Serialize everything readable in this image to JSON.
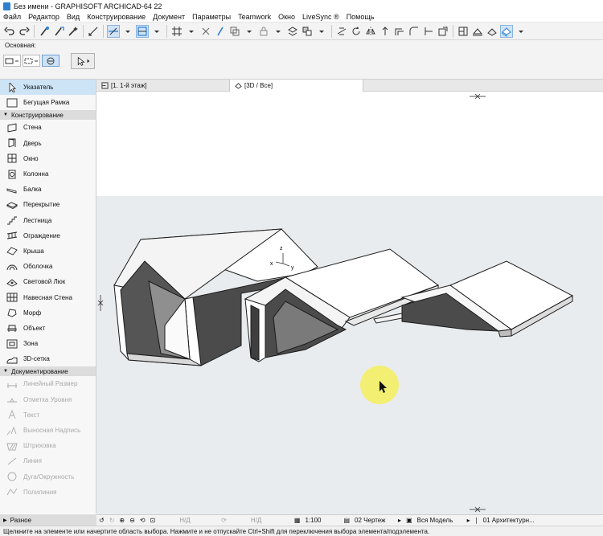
{
  "window": {
    "title": "Без имени - GRAPHISOFT ARCHICAD-64 22"
  },
  "menu": [
    "Файл",
    "Редактор",
    "Вид",
    "Конструирование",
    "Документ",
    "Параметры",
    "Teamwork",
    "Окно",
    "LiveSync ®",
    "Помощь"
  ],
  "infobox": {
    "label": "Основная:"
  },
  "tabs": [
    {
      "label": "[1. 1-й этаж]"
    },
    {
      "label": "[3D / Все]"
    }
  ],
  "toolbox": {
    "top_tools": [
      {
        "label": "Указатель",
        "icon": "pointer-icon"
      },
      {
        "label": "Бегущая Рамка",
        "icon": "marquee-icon"
      }
    ],
    "design_section": "Конструирование",
    "design_tools": [
      {
        "label": "Стена",
        "icon": "wall-icon"
      },
      {
        "label": "Дверь",
        "icon": "door-icon"
      },
      {
        "label": "Окно",
        "icon": "window-icon"
      },
      {
        "label": "Колонна",
        "icon": "column-icon"
      },
      {
        "label": "Балка",
        "icon": "beam-icon"
      },
      {
        "label": "Перекрытие",
        "icon": "slab-icon"
      },
      {
        "label": "Лестница",
        "icon": "stair-icon"
      },
      {
        "label": "Ограждение",
        "icon": "railing-icon"
      },
      {
        "label": "Крыша",
        "icon": "roof-icon"
      },
      {
        "label": "Оболочка",
        "icon": "shell-icon"
      },
      {
        "label": "Световой Люк",
        "icon": "skylight-icon"
      },
      {
        "label": "Навесная Стена",
        "icon": "curtain-wall-icon"
      },
      {
        "label": "Морф",
        "icon": "morph-icon"
      },
      {
        "label": "Объект",
        "icon": "object-icon"
      },
      {
        "label": "Зона",
        "icon": "zone-icon"
      },
      {
        "label": "3D-сетка",
        "icon": "mesh-icon"
      }
    ],
    "doc_section": "Документирование",
    "doc_tools": [
      {
        "label": "Линейный Размер",
        "icon": "dimension-icon"
      },
      {
        "label": "Отметка Уровня",
        "icon": "level-icon"
      },
      {
        "label": "Текст",
        "icon": "text-icon"
      },
      {
        "label": "Выносная Надпись",
        "icon": "label-icon"
      },
      {
        "label": "Штриховка",
        "icon": "fill-icon"
      },
      {
        "label": "Линия",
        "icon": "line-icon"
      },
      {
        "label": "Дуга/Окружность",
        "icon": "arc-icon"
      },
      {
        "label": "Полилиния",
        "icon": "polyline-icon"
      }
    ],
    "misc_section": "Разное"
  },
  "statusbar": {
    "zoom_a": "Н/Д",
    "zoom_b": "Н/Д",
    "scale": "1:100",
    "layer_combo": "02 Чертеж",
    "model_view": "Вся Модель",
    "pen_set": "01 Архитектурн..."
  },
  "hint": "Щелкните на элементе или начертите область выбора. Нажмите и не отпускайте Ctrl+Shift для переключения выбора элемента/подэлемента.",
  "axes": {
    "x": "x",
    "y": "y",
    "z": "z"
  },
  "colors": {
    "selection": "#cde4f7",
    "view_background": "#e9ecee",
    "cursor_highlight": "#f4f04a"
  }
}
